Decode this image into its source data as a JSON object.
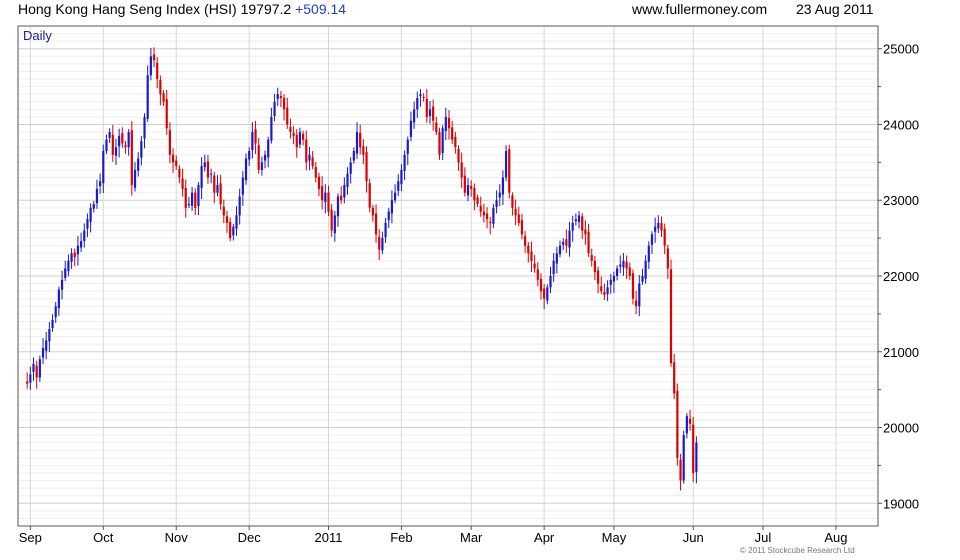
{
  "header": {
    "title": "Hong Kong Hang Seng Index (HSI)",
    "last": "19797.2",
    "change": "+509.14",
    "site": "www.fullermoney.com",
    "date": "23 Aug 2011",
    "copyright": "© 2011 Stockcube Research Ltd"
  },
  "chart_data": {
    "type": "candlestick",
    "period_label": "Daily",
    "up_color": "#1a1acc",
    "down_color": "#dd0000",
    "ylim": [
      18700,
      25300
    ],
    "y_ticks": [
      19000,
      20000,
      21000,
      22000,
      23000,
      24000,
      25000
    ],
    "y_tick_labels": [
      "19000",
      "20000",
      "21000",
      "22000",
      "23000",
      "24000",
      "25000"
    ],
    "x_labels": [
      {
        "label": "Sep",
        "day": 2
      },
      {
        "label": "Oct",
        "day": 25
      },
      {
        "label": "Nov",
        "day": 48
      },
      {
        "label": "Dec",
        "day": 71
      },
      {
        "label": "2011",
        "day": 96
      },
      {
        "label": "Feb",
        "day": 119
      },
      {
        "label": "Mar",
        "day": 141
      },
      {
        "label": "Apr",
        "day": 164
      },
      {
        "label": "May",
        "day": 186
      },
      {
        "label": "Jun",
        "day": 211
      },
      {
        "label": "Jul",
        "day": 233
      },
      {
        "label": "Aug",
        "day": 256
      }
    ],
    "grid": true,
    "closes": [
      20620,
      20580,
      20700,
      20840,
      20660,
      20900,
      21050,
      21150,
      21300,
      21420,
      21600,
      21820,
      21950,
      22100,
      22200,
      22300,
      22250,
      22400,
      22460,
      22600,
      22750,
      22900,
      22950,
      23150,
      23250,
      23650,
      23800,
      23900,
      23600,
      23700,
      23850,
      23750,
      23700,
      23900,
      23200,
      23400,
      23550,
      23780,
      24100,
      24650,
      24900,
      24850,
      24600,
      24400,
      24300,
      23950,
      23600,
      23500,
      23450,
      23300,
      23150,
      22900,
      22950,
      23100,
      22900,
      23200,
      23450,
      23500,
      23300,
      23350,
      23100,
      23200,
      22950,
      22800,
      22700,
      22500,
      22650,
      22800,
      23050,
      23300,
      23550,
      23650,
      23900,
      23750,
      23400,
      23500,
      23600,
      23800,
      24100,
      24300,
      24400,
      24350,
      24200,
      24000,
      23900,
      23850,
      23700,
      23900,
      23800,
      23500,
      23600,
      23450,
      23300,
      23150,
      23000,
      23100,
      22850,
      22600,
      22800,
      23050,
      23000,
      23200,
      23350,
      23500,
      23650,
      23900,
      23700,
      23600,
      23250,
      22900,
      22800,
      22550,
      22350,
      22500,
      22700,
      22850,
      23000,
      23100,
      23250,
      23400,
      23600,
      23800,
      24050,
      24200,
      24350,
      24400,
      24350,
      24100,
      24200,
      24050,
      23900,
      23600,
      23950,
      24100,
      23950,
      23800,
      23700,
      23500,
      23300,
      23100,
      23200,
      23150,
      23000,
      22950,
      22850,
      22800,
      22750,
      22700,
      22900,
      23000,
      23100,
      23300,
      23650,
      23100,
      22900,
      22800,
      22700,
      22550,
      22400,
      22300,
      22200,
      22100,
      21950,
      21800,
      21700,
      21850,
      22000,
      22200,
      22300,
      22400,
      22450,
      22400,
      22600,
      22700,
      22750,
      22800,
      22600,
      22550,
      22300,
      22200,
      22050,
      21900,
      21800,
      21750,
      21850,
      21950,
      22000,
      22100,
      22150,
      22200,
      22100,
      22000,
      21700,
      21600,
      21900,
      22000,
      22200,
      22400,
      22550,
      22650,
      22700,
      22600,
      22400,
      22100,
      20850,
      20450,
      19600,
      19300,
      19900,
      20150,
      20050,
      19400,
      19800
    ],
    "xlim_days": 268
  }
}
